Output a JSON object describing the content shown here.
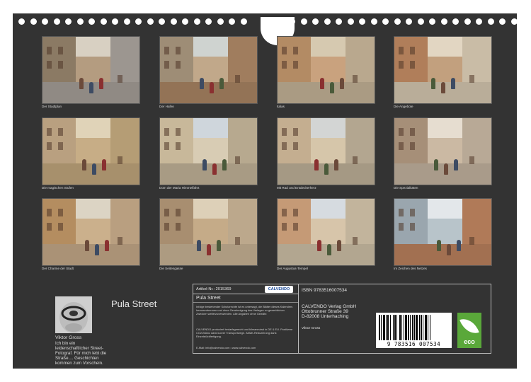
{
  "calendar": {
    "title": "Pula Street",
    "author": "Viktor Gross",
    "bio": "Ich bin ein leidenschaftlicher Street-Fotograf. Für mich lebt die Straße.... Geschichten kommen zum Vorschein."
  },
  "photos": [
    {
      "caption": "Der Stadtplan",
      "palette": [
        "#d8d0c2",
        "#8b7a64",
        "#b49c80",
        "#9c9690"
      ]
    },
    {
      "caption": "Der Hafen",
      "palette": [
        "#cfd3d0",
        "#9e8d76",
        "#c1a88a",
        "#a07d5e"
      ]
    },
    {
      "caption": "Italas",
      "palette": [
        "#d6c9b0",
        "#b38b64",
        "#c9a27e",
        "#b9a88e"
      ]
    },
    {
      "caption": "Die Angebote",
      "palette": [
        "#e2d6c2",
        "#b07e5a",
        "#c2a07e",
        "#c9bca6"
      ]
    },
    {
      "caption": "Die magischen Stufen",
      "palette": [
        "#e0d3b8",
        "#b9a080",
        "#c7ad86",
        "#b59d75"
      ]
    },
    {
      "caption": "Dom der Maria Himmelfahrt",
      "palette": [
        "#cfd6dc",
        "#c8b89a",
        "#d8ccb4",
        "#b7a98f"
      ]
    },
    {
      "caption": "Mit Rad und Entdeckerherz",
      "palette": [
        "#d3d5d4",
        "#c4ae90",
        "#d6c6aa",
        "#b3a690"
      ]
    },
    {
      "caption": "Die Spezialitäten",
      "palette": [
        "#e6ddd0",
        "#a68f78",
        "#cbb9a3",
        "#b8a996"
      ]
    },
    {
      "caption": "Der Charme der Stadt",
      "palette": [
        "#dcd4c4",
        "#b48d60",
        "#cbb08c",
        "#b99f80"
      ]
    },
    {
      "caption": "Die Seitengasse",
      "palette": [
        "#ddd0b8",
        "#a88e70",
        "#c5ab88",
        "#bca88c"
      ]
    },
    {
      "caption": "Der Augustus-Tempel",
      "palette": [
        "#d6dbe0",
        "#c59a76",
        "#d7c5aa",
        "#c2b49c"
      ]
    },
    {
      "caption": "Im Zeichen des Netzes",
      "palette": [
        "#e3e7ea",
        "#9aa6ae",
        "#b8c4ca",
        "#b07a58"
      ]
    }
  ],
  "info": {
    "article": "Artikel-Nr.: 2015369",
    "publisher_logo": "CALVENDO",
    "title": "Pula Street",
    "legal_1": "Infolge bestehender Schutzrechte ist es untersagt, die Blätter dieses Kalenders herauszutrennen und ohne Genehmigung des Verlages zu gewerblichen Zwecken weiterzuverwenden. Alle Angaben ohne Gewähr.",
    "legal_2": "CALVENDO produziert bedarfsgerecht und klimaneutral in DE & EU. Positivere CO2-Bilanz dank kurzer Transportwege. AMaK-Reduzierung dank Einzelstückfertigung.",
    "contact": "E-Mail: info@calvendo.com • www.calvendo.com",
    "isbn": "ISBN 9783516007534",
    "address_1": "CALVENDO Verlag GmbH",
    "address_2": "Ottobrunner Straße 39",
    "address_3": "D-82008 Unterhaching",
    "author_small": "Viktor Gross",
    "barcode_digits": "9 783516 007534",
    "eco_label": "eco"
  },
  "colors": {
    "board": "#333333",
    "eco_green": "#5aa83a"
  }
}
